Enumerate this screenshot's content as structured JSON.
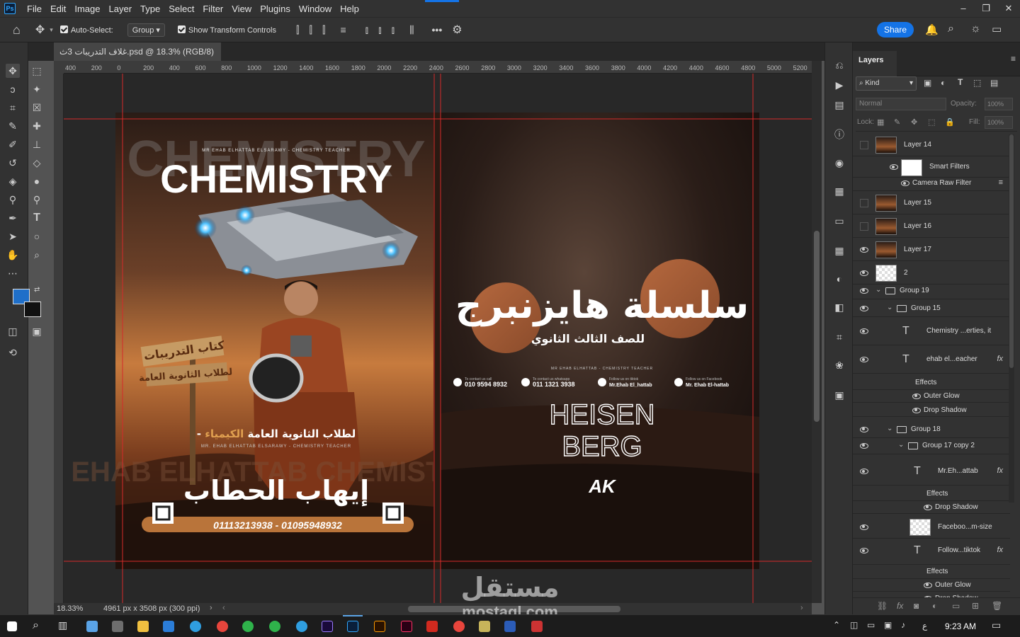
{
  "menu": {
    "logo": "Ps",
    "items": [
      "File",
      "Edit",
      "Image",
      "Layer",
      "Type",
      "Select",
      "Filter",
      "View",
      "Plugins",
      "Window",
      "Help"
    ],
    "window_controls": [
      "–",
      "❐",
      "✕"
    ]
  },
  "options": {
    "auto_select_label": "Auto-Select:",
    "auto_select_value": "Group",
    "show_transform_label": "Show Transform Controls",
    "more_label": "•••",
    "share_label": "Share"
  },
  "document": {
    "tab_title": "غلاف التدريبات 3ث.psd @ 18.3% (RGB/8)",
    "tab_close": "×",
    "zoom": "18.33%",
    "doc_info": "4961 px x 3508 px (300 ppi)",
    "ruler_ticks": [
      "400",
      "200",
      "0",
      "200",
      "400",
      "600",
      "800",
      "1000",
      "1200",
      "1400",
      "1600",
      "1800",
      "2000",
      "2200",
      "2400",
      "2600",
      "2800",
      "3000",
      "3200",
      "3400",
      "3600",
      "3800",
      "4000",
      "4200",
      "4400",
      "4600",
      "4800",
      "5000",
      "5200"
    ]
  },
  "artwork": {
    "front": {
      "title_big": "CHEMISTRY",
      "title_small": "CHEMISTRY",
      "subtitle": "MR EHAB ELHATTAB ELSARAWY - CHEMISTRY TEACHER",
      "sign_1": "كتاب التدريبات",
      "sign_2": "لطلاب الثانوية العامة",
      "tagline_gold": "الكيمياء",
      "tagline_white": "- لطلاب الثانوية العامة",
      "teacher_en": "MR. EHAB ELHATTAB ELSARAWY - CHEMISTRY TEACHER",
      "name_ar": "إيهاب الحطاب",
      "phones": "01113213938 - 01095948932",
      "watermark_text": "EHAB ELHATTAB CHEMISTRY"
    },
    "back": {
      "series_ar": "سلسلة هايزنبرج",
      "grade_ar": "للصف الثالث الثانوي",
      "tagline": "MR EHAB ELHATTAB - CHEMISTRY TEACHER",
      "contacts": [
        {
          "icon": "phone-icon",
          "caption": "To contact us call",
          "value": "010 9594 8932"
        },
        {
          "icon": "whatsapp-icon",
          "caption": "To contact us whatsapp",
          "value": "011 1321 3938"
        },
        {
          "icon": "tiktok-icon",
          "caption": "Follow us on tiktok",
          "value": "Mr.Ehab El_hattab"
        },
        {
          "icon": "facebook-icon",
          "caption": "Follow us on Facebook",
          "value": "Mr. Ehab El-hattab"
        }
      ],
      "logo_line1": "HEISEN",
      "logo_line2": "BERG",
      "ak_logo": "AK"
    }
  },
  "layers": {
    "tab": "Layers",
    "filter_kind": "Kind",
    "blend_mode": "Normal",
    "opacity_label": "Opacity:",
    "opacity_value": "100%",
    "lock_label": "Lock:",
    "fill_label": "Fill:",
    "fill_value": "100%",
    "rows": [
      {
        "name": "Layer 14",
        "type": "image",
        "visible": false,
        "indent": 0
      },
      {
        "name": "Smart Filters",
        "type": "smartfilter",
        "visible": true,
        "indent": 1
      },
      {
        "name": "Camera Raw Filter",
        "type": "filter",
        "visible": true,
        "indent": 2
      },
      {
        "name": "Layer 15",
        "type": "image",
        "visible": false,
        "indent": 0
      },
      {
        "name": "Layer 16",
        "type": "image",
        "visible": false,
        "indent": 0
      },
      {
        "name": "Layer 17",
        "type": "image",
        "visible": true,
        "indent": 0
      },
      {
        "name": "2",
        "type": "transparent",
        "visible": true,
        "indent": 0
      },
      {
        "name": "Group 19",
        "type": "group",
        "visible": true,
        "indent": 0
      },
      {
        "name": "Group 15",
        "type": "group",
        "visible": true,
        "indent": 1
      },
      {
        "name": "Chemistry ...erties, it",
        "type": "text",
        "visible": true,
        "indent": 2
      },
      {
        "name": "ehab el...eacher",
        "type": "text",
        "visible": true,
        "indent": 2,
        "fx": true
      },
      {
        "name": "Effects",
        "type": "effects",
        "indent": 3
      },
      {
        "name": "Outer Glow",
        "type": "effect",
        "indent": 3
      },
      {
        "name": "Drop Shadow",
        "type": "effect",
        "indent": 3
      },
      {
        "name": "Group 18",
        "type": "group",
        "visible": true,
        "indent": 1
      },
      {
        "name": "Group 17 copy 2",
        "type": "group",
        "visible": true,
        "indent": 2
      },
      {
        "name": "Mr.Eh...attab",
        "type": "text",
        "visible": true,
        "indent": 3,
        "fx": true
      },
      {
        "name": "Effects",
        "type": "effects",
        "indent": 4
      },
      {
        "name": "Drop Shadow",
        "type": "effect",
        "indent": 4
      },
      {
        "name": "Faceboo...m-size",
        "type": "transparent",
        "visible": true,
        "indent": 3
      },
      {
        "name": "Follow...tiktok",
        "type": "text",
        "visible": true,
        "indent": 3,
        "fx": true
      },
      {
        "name": "Effects",
        "type": "effects",
        "indent": 4
      },
      {
        "name": "Outer Glow",
        "type": "effect",
        "indent": 4
      },
      {
        "name": "Drop Shadow",
        "type": "effect",
        "indent": 4
      }
    ],
    "fx_label": "fx"
  },
  "watermark": {
    "arabic": "مستقل",
    "latin": "mostaql.com"
  },
  "taskbar": {
    "time": "9:23 AM",
    "lang": "ع"
  }
}
